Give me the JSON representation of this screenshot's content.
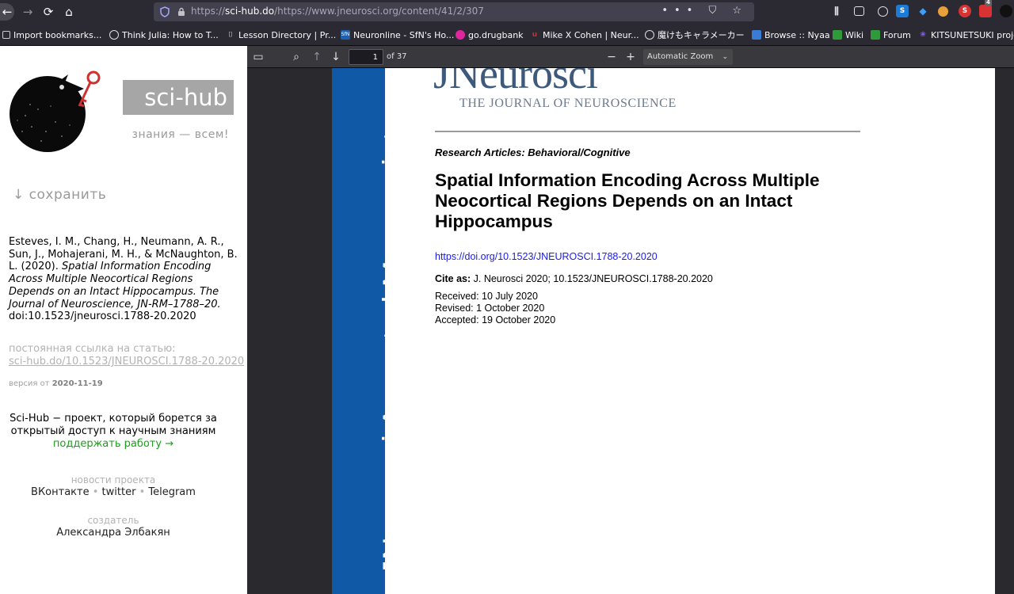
{
  "browser": {
    "url_scheme": "https://",
    "url_host": "sci-hub.do",
    "url_path": "/https://www.jneurosci.org/content/41/2/307",
    "page_actions": "••• ⛉ ☆",
    "notification_badge": "4"
  },
  "bookmarks": [
    {
      "label": "Import bookmarks...",
      "icon": "import-icon",
      "color": "#5b5b66"
    },
    {
      "label": "Think Julia: How to T...",
      "icon": "globe-icon",
      "color": "#5b5b66"
    },
    {
      "label": "Lesson Directory | Pr...",
      "icon": "bookmark-favicon",
      "color": "#5b5b66"
    },
    {
      "label": "Neuronline - SfN's Ho...",
      "icon": "sfn-favicon",
      "color": "#1f5fb0"
    },
    {
      "label": "go.drugbank",
      "icon": "drugbank-favicon",
      "color": "#e0269f"
    },
    {
      "label": "Mike X Cohen | Neur...",
      "icon": "udemy-favicon",
      "color": "#c9302c"
    },
    {
      "label": "魔けもキャラメーカー",
      "icon": "globe-icon",
      "color": "#5b5b66"
    },
    {
      "label": "Browse :: Nyaa",
      "icon": "nyaa-favicon",
      "color": "#3a7bd5"
    },
    {
      "label": "Wiki",
      "icon": "wiki-favicon",
      "color": "#2e9a3a"
    },
    {
      "label": "Forum",
      "icon": "forum-favicon",
      "color": "#2e9a3a"
    },
    {
      "label": "KITSUNETSUKI proje",
      "icon": "paw-favicon",
      "color": "#8a5cf6"
    }
  ],
  "sidebar": {
    "brand": "sci-hub",
    "tagline": "знания — всем!",
    "save": "↓ сохранить",
    "citation_authors": "Esteves, I. M., Chang, H., Neumann, A. R., Sun, J., Mohajerani, M. H., & McNaughton, B. L. (2020). ",
    "citation_title": "Spatial Information Encoding Across Multiple Neocortical Regions Depends on an Intact Hippocampus. The Journal of Neuroscience, JN-RM–1788–20.",
    "citation_doi": " doi:10.1523/jneurosci.1788-20.2020",
    "permalink_label": "постоянная ссылка на статью:",
    "permalink": "sci-hub.do/10.1523/JNEUROSCI.1788-20.2020",
    "version_label": "версия от ",
    "version_date": "2020-11-19",
    "mission": "Sci-Hub − проект, который борется за открытый доступ к научным знаниям",
    "donate": "поддержать работу →",
    "news_label": "новости проекта",
    "social_vk": "ВКонтакте",
    "social_twitter": "twitter",
    "social_telegram": "Telegram",
    "separator": " • ",
    "creator_label": "создатель",
    "creator": "Александра Элбакян"
  },
  "pdf": {
    "page_number": "1",
    "page_total": "of 37",
    "zoom": "Automatic Zoom",
    "banner": "JNeurosci Accepted Manuscript",
    "journal_logo": "JNeurosci",
    "journal_subtitle": "THE JOURNAL OF NEUROSCIENCE",
    "section": "Research Articles: Behavioral/Cognitive",
    "title": "Spatial Information Encoding Across Multiple Neocortical Regions Depends on an Intact Hippocampus",
    "doi": "https://doi.org/10.1523/JNEUROSCI.1788-20.2020",
    "cite_label": "Cite as:",
    "cite_value": " J. Neurosci 2020; 10.1523/JNEUROSCI.1788-20.2020",
    "received": "Received: 10 July 2020",
    "revised": "Revised: 1 October 2020",
    "accepted": "Accepted: 19 October 2020"
  },
  "colors": {
    "banner": "#1059a6",
    "donate": "#1aa01a",
    "doi_link": "#1a1aee"
  }
}
